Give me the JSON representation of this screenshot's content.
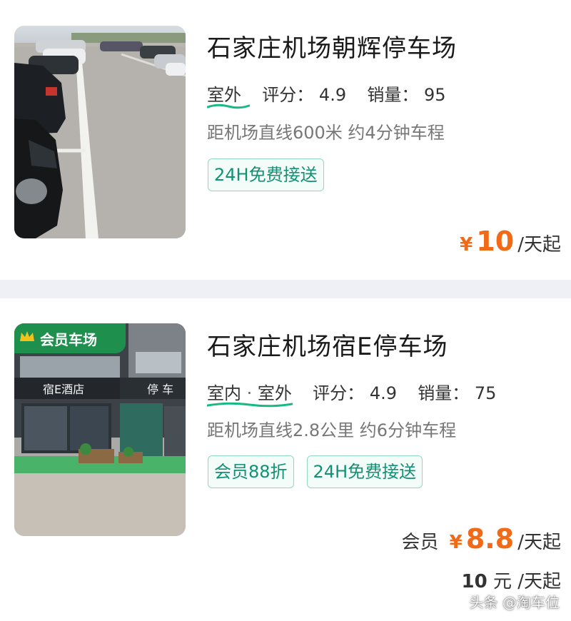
{
  "listings": [
    {
      "title": "石家庄机场朝辉停车场",
      "location_type": [
        "室外"
      ],
      "rating_label": "评分：",
      "rating": "4.9",
      "sales_label": "销量：",
      "sales": "95",
      "distance": "距机场直线600米 约4分钟车程",
      "badges": [
        "24H免费接送"
      ],
      "price": {
        "currency": "¥",
        "amount": "10",
        "unit": "/天起"
      }
    },
    {
      "title": "石家庄机场宿E停车场",
      "location_type": [
        "室内",
        "室外"
      ],
      "location_sep": " · ",
      "rating_label": "评分：",
      "rating": "4.9",
      "sales_label": "销量：",
      "sales": "75",
      "distance": "距机场直线2.8公里 约6分钟车程",
      "badges": [
        "会员88折",
        "24H免费接送"
      ],
      "ribbon": "会员车场",
      "member_price": {
        "label": "会员",
        "currency": "¥",
        "amount": "8.8",
        "unit": "/天起"
      },
      "original_price": {
        "amount": "10",
        "unit": " 元 /天起"
      },
      "storefront_sign_left": "宿E酒店",
      "storefront_sign_right": "停 车"
    }
  ],
  "watermark": "头条 @淘车位",
  "colors": {
    "accent_price": "#f06a17",
    "badge_text": "#139174",
    "badge_border": "#8fd8c3",
    "wave": "#19b985"
  }
}
